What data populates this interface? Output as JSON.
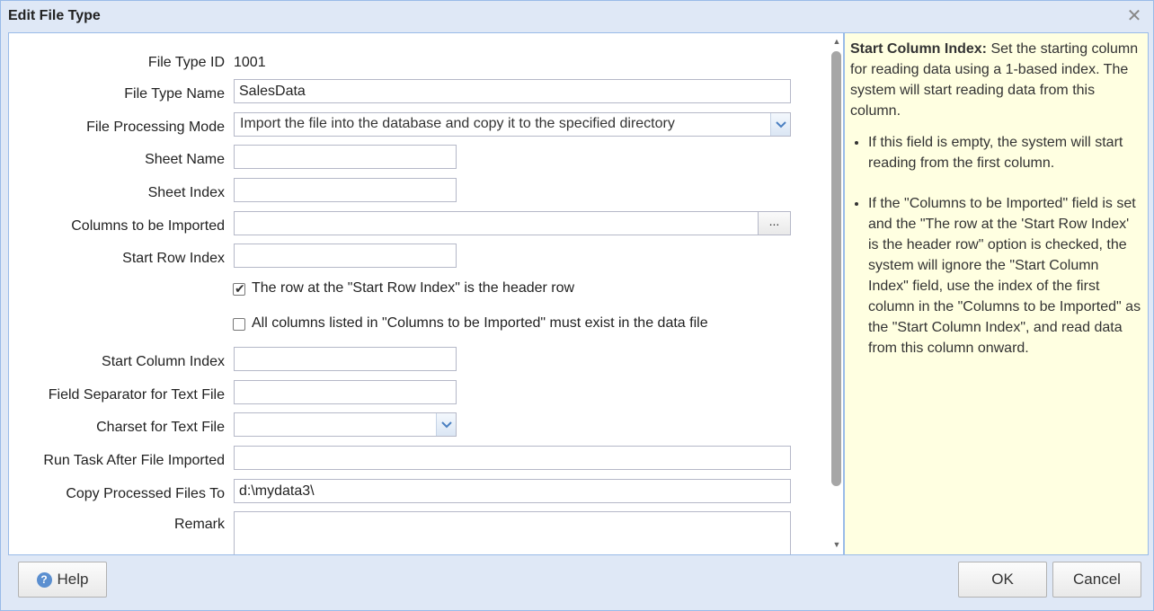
{
  "dialog": {
    "title": "Edit File Type",
    "close_glyph": "✕"
  },
  "form": {
    "file_type_id": {
      "label": "File Type ID",
      "value": "1001"
    },
    "file_type_name": {
      "label": "File Type Name",
      "value": "SalesData"
    },
    "file_processing_mode": {
      "label": "File Processing Mode",
      "value": "Import the file into the database and copy it to the specified directory"
    },
    "sheet_name": {
      "label": "Sheet Name",
      "value": ""
    },
    "sheet_index": {
      "label": "Sheet Index",
      "value": ""
    },
    "columns_to_import": {
      "label": "Columns to be Imported",
      "value": "",
      "browse_label": "..."
    },
    "start_row_index": {
      "label": "Start Row Index",
      "value": ""
    },
    "header_row_checkbox": {
      "label": "The row at the \"Start Row Index\" is the header row",
      "checked": true
    },
    "all_columns_checkbox": {
      "label": "All columns listed in \"Columns to be Imported\" must exist in the data file",
      "checked": false
    },
    "start_column_index": {
      "label": "Start Column Index",
      "value": ""
    },
    "field_separator": {
      "label": "Field Separator for Text File",
      "value": ""
    },
    "charset": {
      "label": "Charset for Text File",
      "value": ""
    },
    "run_task_after_import": {
      "label": "Run Task After File Imported",
      "value": ""
    },
    "copy_processed_to": {
      "label": "Copy Processed Files To",
      "value": "d:\\mydata3\\"
    },
    "remark": {
      "label": "Remark",
      "value": ""
    }
  },
  "help": {
    "title": "Start Column Index:",
    "intro": "Set the starting column for reading data using a 1-based index. The system will start reading data from this column.",
    "bullets": [
      "If this field is empty, the system will start reading from the first column.",
      "If the \"Columns to be Imported\" field is set and the \"The row at the 'Start Row Index' is the header row\" option is checked, the system will ignore the \"Start Column Index\" field, use the index of the first column in the \"Columns to be Imported\" as the \"Start Column Index\", and read data from this column onward."
    ]
  },
  "footer": {
    "help_label": "Help",
    "ok_label": "OK",
    "cancel_label": "Cancel"
  },
  "icons": {
    "help": "help-circle-icon",
    "close": "close-icon",
    "dropdown": "chevron-down-icon",
    "checkbox_tick": "checkmark-icon"
  },
  "colors": {
    "dialog_background": "#dfe8f6",
    "border": "#99bbe8",
    "help_panel_background": "#ffffe1",
    "help_icon": "#5b8fd0"
  }
}
